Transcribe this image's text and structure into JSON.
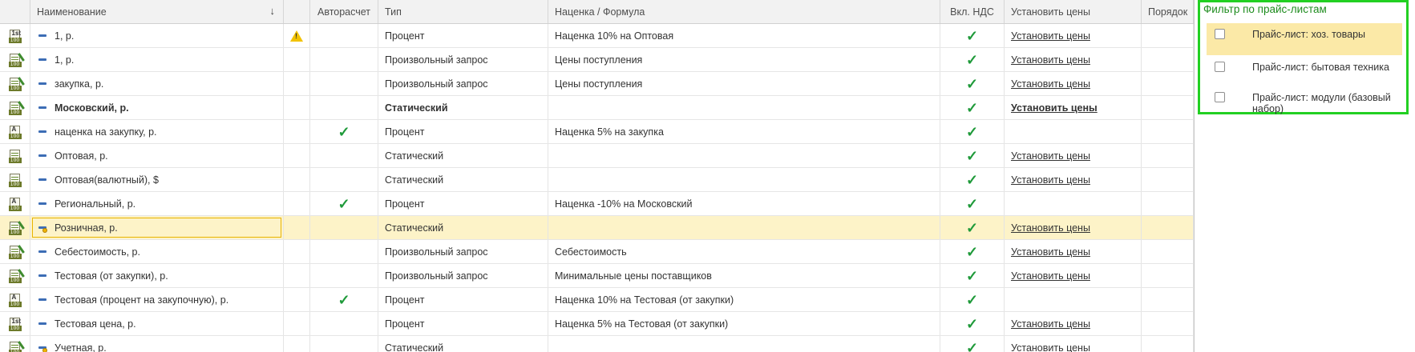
{
  "columns": {
    "name": "Наименование",
    "autocalc": "Авторасчет",
    "type": "Тип",
    "markup": "Наценка / Формула",
    "vat": "Вкл. НДС",
    "set_prices": "Установить цены",
    "order": "Порядок"
  },
  "sort_indicator": "↓",
  "rows": [
    {
      "icon": "price-type-1st-icon",
      "name": "1, р.",
      "warning": true,
      "autocalc": false,
      "type": "Процент",
      "markup": "Наценка 10% на Оптовая",
      "vat": true,
      "set_prices": "Установить цены"
    },
    {
      "icon": "price-type-edit-icon",
      "name": "1, р.",
      "warning": false,
      "autocalc": false,
      "type": "Произвольный запрос",
      "markup": "Цены поступления",
      "vat": true,
      "set_prices": "Установить цены"
    },
    {
      "icon": "price-type-edit-icon",
      "name": "закупка, р.",
      "warning": false,
      "autocalc": false,
      "type": "Произвольный запрос",
      "markup": "Цены поступления",
      "vat": true,
      "set_prices": "Установить цены"
    },
    {
      "icon": "price-type-edit-icon",
      "name": "Московский, р.",
      "warning": false,
      "autocalc": false,
      "type": "Статический",
      "markup": "",
      "vat": true,
      "set_prices": "Установить цены",
      "bold": true
    },
    {
      "icon": "price-type-auto-icon",
      "name": "наценка на закупку, р.",
      "warning": false,
      "autocalc": true,
      "type": "Процент",
      "markup": "Наценка 5% на закупка",
      "vat": true,
      "set_prices": ""
    },
    {
      "icon": "price-type-static-icon",
      "name": "Оптовая, р.",
      "warning": false,
      "autocalc": false,
      "type": "Статический",
      "markup": "",
      "vat": true,
      "set_prices": "Установить цены"
    },
    {
      "icon": "price-type-static-icon",
      "name": "Оптовая(валютный), $",
      "warning": false,
      "autocalc": false,
      "type": "Статический",
      "markup": "",
      "vat": true,
      "set_prices": "Установить цены"
    },
    {
      "icon": "price-type-auto-icon",
      "name": "Региональный, р.",
      "warning": false,
      "autocalc": true,
      "type": "Процент",
      "markup": "Наценка -10% на Московский",
      "vat": true,
      "set_prices": ""
    },
    {
      "icon": "price-type-edit-icon",
      "name": "Розничная, р.",
      "warning": false,
      "autocalc": false,
      "type": "Статический",
      "markup": "",
      "vat": true,
      "set_prices": "Установить цены",
      "selected": true,
      "dot": true
    },
    {
      "icon": "price-type-edit-icon",
      "name": "Себестоимость, р.",
      "warning": false,
      "autocalc": false,
      "type": "Произвольный запрос",
      "markup": "Себестоимость",
      "vat": true,
      "set_prices": "Установить цены"
    },
    {
      "icon": "price-type-edit-icon",
      "name": "Тестовая (от закупки), р.",
      "warning": false,
      "autocalc": false,
      "type": "Произвольный запрос",
      "markup": "Минимальные цены поставщиков",
      "vat": true,
      "set_prices": "Установить цены"
    },
    {
      "icon": "price-type-auto-icon",
      "name": "Тестовая (процент на закупочную), р.",
      "warning": false,
      "autocalc": true,
      "type": "Процент",
      "markup": "Наценка 10% на Тестовая (от закупки)",
      "vat": true,
      "set_prices": ""
    },
    {
      "icon": "price-type-1st-icon",
      "name": "Тестовая цена, р.",
      "warning": false,
      "autocalc": false,
      "type": "Процент",
      "markup": "Наценка 5% на Тестовая (от закупки)",
      "vat": true,
      "set_prices": "Установить цены"
    },
    {
      "icon": "price-type-edit-icon",
      "name": "Учетная, р.",
      "warning": false,
      "autocalc": false,
      "type": "Статический",
      "markup": "",
      "vat": true,
      "set_prices": "Установить цены",
      "dot": true
    }
  ],
  "filter": {
    "title": "Фильтр по прайс-листам",
    "items": [
      {
        "label": "Прайс-лист: хоз. товары",
        "checked": false,
        "active": true
      },
      {
        "label": "Прайс-лист: бытовая техника",
        "checked": false,
        "active": false
      },
      {
        "label": "Прайс-лист: модули (базовый набор)",
        "checked": false,
        "active": false
      }
    ]
  },
  "colors": {
    "accent_green": "#22d022",
    "check_green": "#1f9a3a",
    "selection": "#fdf3c8"
  }
}
